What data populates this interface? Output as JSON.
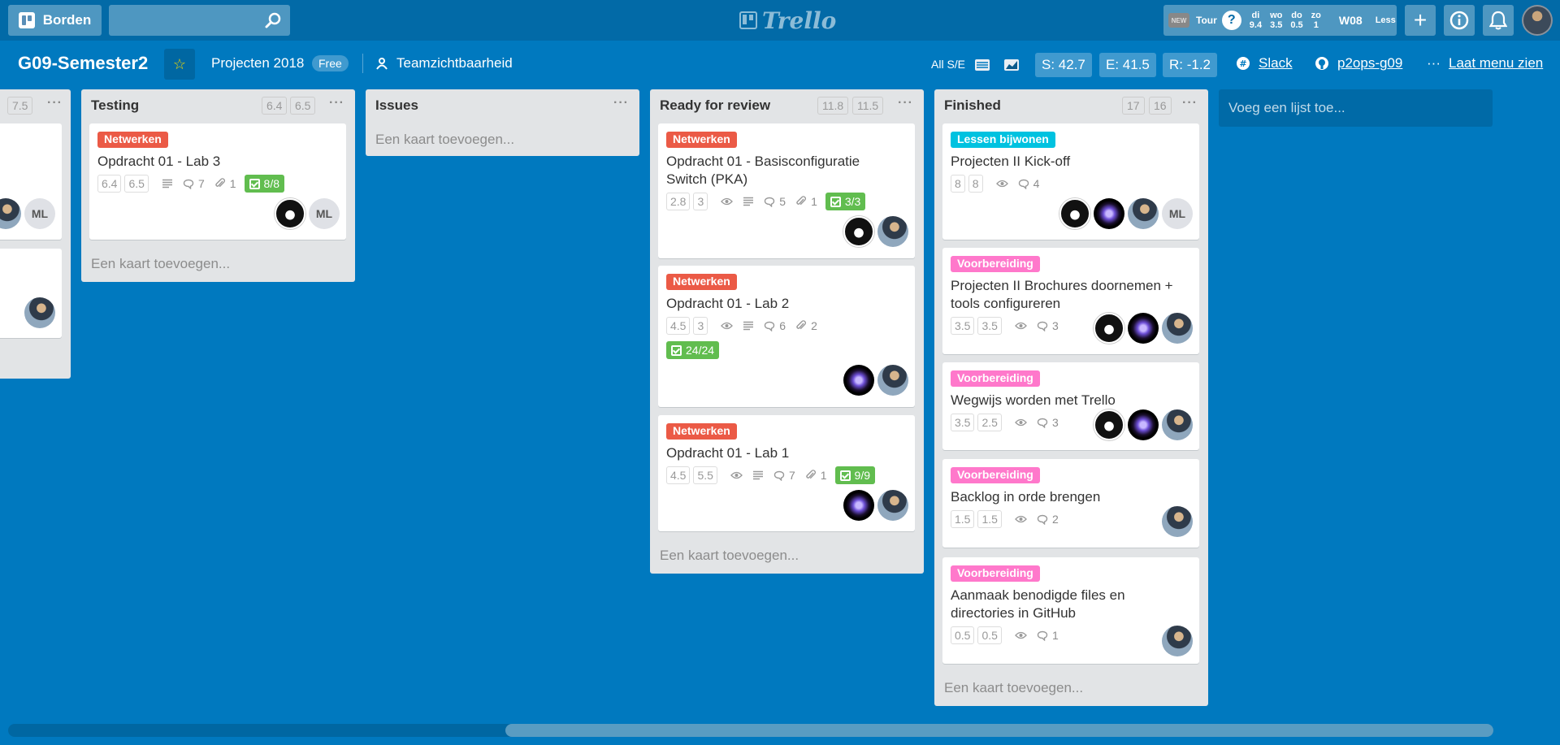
{
  "topbar": {
    "boards_label": "Borden",
    "search_value": "",
    "logo_text": "Trello",
    "new_badge": "NEW",
    "tour_label": "Tour",
    "days": [
      {
        "day": "di",
        "value": "9.4"
      },
      {
        "day": "wo",
        "value": "3.5"
      },
      {
        "day": "do",
        "value": "0.5"
      },
      {
        "day": "zo",
        "value": "1"
      }
    ],
    "week": "W08",
    "less_label": "Less"
  },
  "board": {
    "title": "G09-Semester2",
    "team": "Projecten 2018",
    "plan_badge": "Free",
    "visibility": "Teamzichtbaarheid",
    "all_se": "All S/E",
    "metric_s": "S: 42.7",
    "metric_e": "E: 41.5",
    "metric_r": "R: -1.2",
    "slack": "Slack",
    "github": "p2ops-g09",
    "menu": "Laat menu zien"
  },
  "lists": {
    "partial": {
      "est2": "7.5"
    },
    "testing": {
      "title": "Testing",
      "est1": "6.4",
      "est2": "6.5",
      "add_card": "Een kaart toevoegen...",
      "cards": [
        {
          "label": "Netwerken",
          "label_color": "#eb5a46",
          "title": "Opdracht 01 - Lab 3",
          "est1": "6.4",
          "est2": "6.5",
          "comments": "7",
          "attachments": "1",
          "checklist": "8/8",
          "avatar_initials": "ML"
        }
      ]
    },
    "issues": {
      "title": "Issues",
      "add_card": "Een kaart toevoegen..."
    },
    "review": {
      "title": "Ready for review",
      "est1": "11.8",
      "est2": "11.5",
      "add_card": "Een kaart toevoegen...",
      "cards": [
        {
          "label": "Netwerken",
          "title_line1": "Opdracht 01 - Basisconfiguratie",
          "title_line2": "Switch (PKA)",
          "est1": "2.8",
          "est2": "3",
          "comments": "5",
          "attachments": "1",
          "checklist": "3/3"
        },
        {
          "label": "Netwerken",
          "title": "Opdracht 01 - Lab 2",
          "est1": "4.5",
          "est2": "3",
          "comments": "6",
          "attachments": "2",
          "checklist": "24/24"
        },
        {
          "label": "Netwerken",
          "title": "Opdracht 01 - Lab 1",
          "est1": "4.5",
          "est2": "5.5",
          "comments": "7",
          "attachments": "1",
          "checklist": "9/9"
        }
      ]
    },
    "finished": {
      "title": "Finished",
      "est1": "17",
      "est2": "16",
      "add_card": "Een kaart toevoegen...",
      "cards": [
        {
          "label": "Lessen bijwonen",
          "label_color": "#00c2e0",
          "title": "Projecten II Kick-off",
          "est1": "8",
          "est2": "8",
          "comments": "4",
          "avatar_initials": "ML"
        },
        {
          "label": "Voorbereiding",
          "label_color": "#ff78cb",
          "title_line1": "Projecten II Brochures doornemen +",
          "title_line2": "tools configureren",
          "est1": "3.5",
          "est2": "3.5",
          "comments": "3"
        },
        {
          "label": "Voorbereiding",
          "title": "Wegwijs worden met Trello",
          "est1": "3.5",
          "est2": "2.5",
          "comments": "3"
        },
        {
          "label": "Voorbereiding",
          "title": "Backlog in orde brengen",
          "est1": "1.5",
          "est2": "1.5",
          "comments": "2"
        },
        {
          "label": "Voorbereiding",
          "title_line1": "Aanmaak benodigde files en",
          "title_line2": "directories in GitHub",
          "est1": "0.5",
          "est2": "0.5",
          "comments": "1"
        }
      ]
    },
    "add_list": "Voeg een lijst toe..."
  },
  "partial_card_avatar": "ML",
  "colors": {
    "board_bg": "#0079bf",
    "header_bg": "#026aa7",
    "list_bg": "#e2e4e6",
    "netwerken": "#eb5a46",
    "check_green": "#61bd4f"
  }
}
